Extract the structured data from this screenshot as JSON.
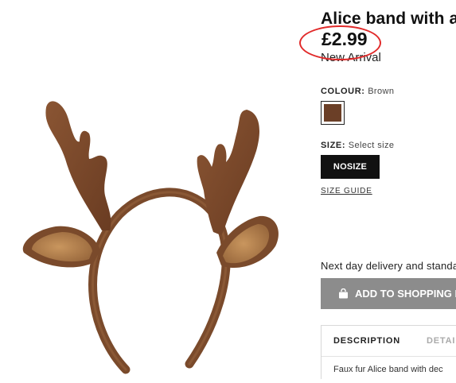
{
  "product": {
    "title": "Alice band with a",
    "price": "£2.99",
    "badge": "New Arrival",
    "image_alt_icon": "reindeer-antler-headband-image"
  },
  "colour": {
    "label": "COLOUR:",
    "value": "Brown",
    "swatch_color": "#6b3f27"
  },
  "size": {
    "label": "SIZE:",
    "value": "Select size",
    "option": "NOSIZE",
    "guide_link": "SIZE GUIDE"
  },
  "delivery": {
    "text": "Next day delivery and standa"
  },
  "cart": {
    "button_label": "ADD TO SHOPPING B",
    "icon": "shopping-bag-icon"
  },
  "details": {
    "tabs": [
      "DESCRIPTION",
      "DETAI"
    ],
    "description_text": "Faux fur Alice band with dec"
  },
  "annotation": {
    "ring_color": "#e12a2a"
  }
}
